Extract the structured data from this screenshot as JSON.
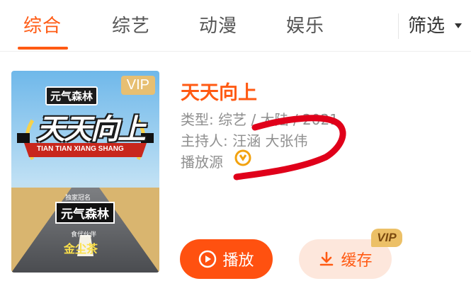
{
  "tabs": [
    {
      "label": "综合",
      "active": true
    },
    {
      "label": "综艺",
      "active": false
    },
    {
      "label": "动漫",
      "active": false
    },
    {
      "label": "娱乐",
      "active": false
    }
  ],
  "filter": {
    "label": "筛选",
    "icon": "caret-down-icon"
  },
  "result": {
    "poster": {
      "vip_badge": "VIP",
      "brand_top": "元气森林",
      "show_logo": "天天向上",
      "pinyin": "TIAN TIAN XIANG SHANG",
      "sponsor_caption": "独家冠名",
      "sponsor_name": "元气森林",
      "partner_caption": "食代伙伴",
      "partner_name": "金尘茶"
    },
    "title": "天天向上",
    "type_line": "类型: 综艺 / 大陆 / 2021",
    "host_line": "主持人: 汪涵  大张伟",
    "source_label": "播放源",
    "source_icon": "youku-source-icon"
  },
  "actions": {
    "play_label": "播放",
    "cache_label": "缓存",
    "cache_vip": "VIP"
  },
  "colors": {
    "accent": "#ff5a13",
    "play_bg": "#ff5110",
    "cache_bg": "#fde7dc",
    "vip_gold": "#ecc067",
    "annotation": "#e0001a"
  }
}
